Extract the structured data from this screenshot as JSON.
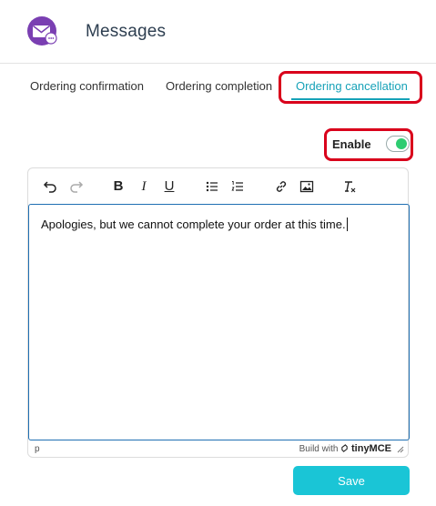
{
  "header": {
    "title": "Messages",
    "icon": "mail-settings-icon"
  },
  "tabs": [
    {
      "label": "Ordering confirmation",
      "active": false
    },
    {
      "label": "Ordering completion",
      "active": false
    },
    {
      "label": "Ordering cancellation",
      "active": true
    }
  ],
  "enable": {
    "label": "Enable",
    "checked": true
  },
  "editor": {
    "toolbar": [
      "undo-icon",
      "redo-icon",
      "bold-icon",
      "italic-icon",
      "underline-icon",
      "bullet-list-icon",
      "numbered-list-icon",
      "link-icon",
      "image-icon",
      "clear-formatting-icon"
    ],
    "content": "Apologies, but we cannot complete your order at this time.",
    "status_path": "p",
    "brand_prefix": "Build with",
    "brand_name": "tinyMCE"
  },
  "save_label": "Save",
  "colors": {
    "accent": "#17a2b8",
    "button": "#1ac5d6",
    "toggle_on": "#2ecc71",
    "highlight": "#d9001b",
    "icon_bg": "#7a3fb2"
  }
}
